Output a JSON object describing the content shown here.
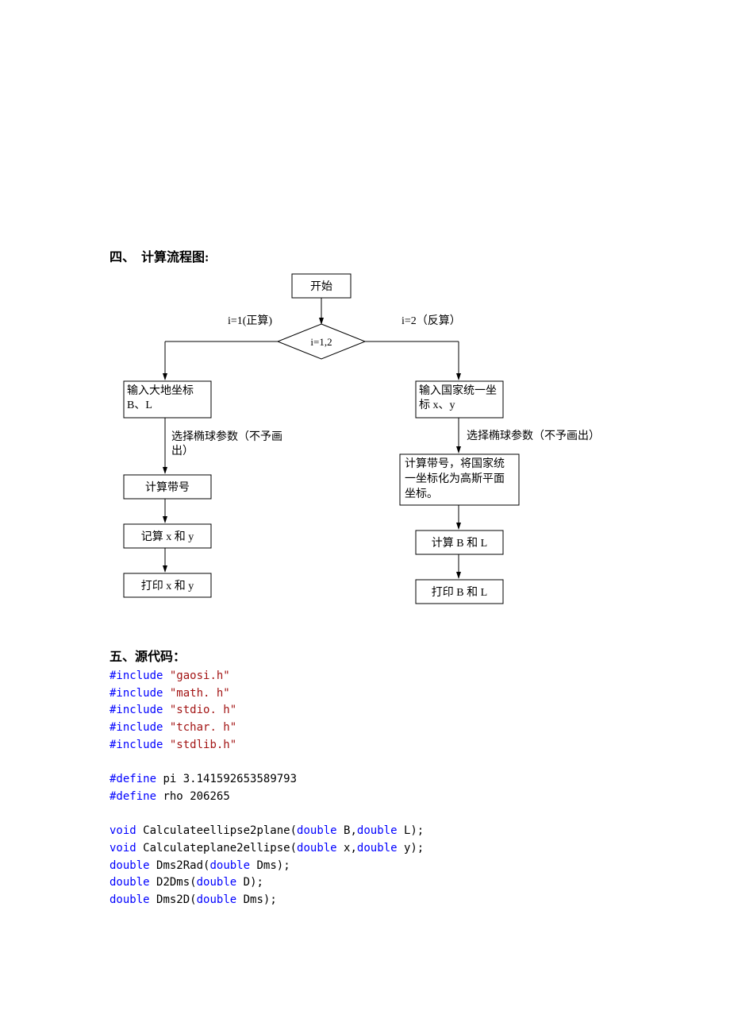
{
  "section4_title": "四、　计算流程图:",
  "section5_title": "五、源代码：",
  "flow": {
    "start": "开始",
    "decision": "i=1,2",
    "branch_left_label": "i=1(正算)",
    "branch_right_label": "i=2（反算）",
    "left": {
      "input": "输入大地坐标 B、L",
      "param_note": "选择椭球参数（不予画出）",
      "step_bandno": "计算带号",
      "step_calc": "记算 x 和 y",
      "step_print": "打印 x 和 y"
    },
    "right": {
      "input": "输入国家统一坐标 x、y",
      "param_note": "选择椭球参数（不予画出）",
      "step_normalize": "计算带号，将国家统一坐标化为高斯平面坐标。",
      "step_calc": "计算 B 和 L",
      "step_print": "打印 B 和 L"
    }
  },
  "code": {
    "include_kw": "#include",
    "define_kw": "#define",
    "type_void": "void",
    "type_double": "double",
    "inc1": "\"gaosi.h\"",
    "inc2": "\"math. h\"",
    "inc3": "\"stdio. h\"",
    "inc4": "\"tchar. h\"",
    "inc5": "\"stdlib.h\"",
    "def1_name": "pi",
    "def1_val": "3.141592653589793",
    "def2_name": "rho",
    "def2_val": "206265",
    "fn1_name": "Calculateellipse2plane",
    "fn1_p1": "B",
    "fn1_p2": "L",
    "fn2_name": "Calculateplane2ellipse",
    "fn2_p1": "x",
    "fn2_p2": "y",
    "fn3_name": "Dms2Rad",
    "fn3_p1": "Dms",
    "fn4_name": "D2Dms",
    "fn4_p1": "D",
    "fn5_name": "Dms2D",
    "fn5_p1": "Dms"
  }
}
